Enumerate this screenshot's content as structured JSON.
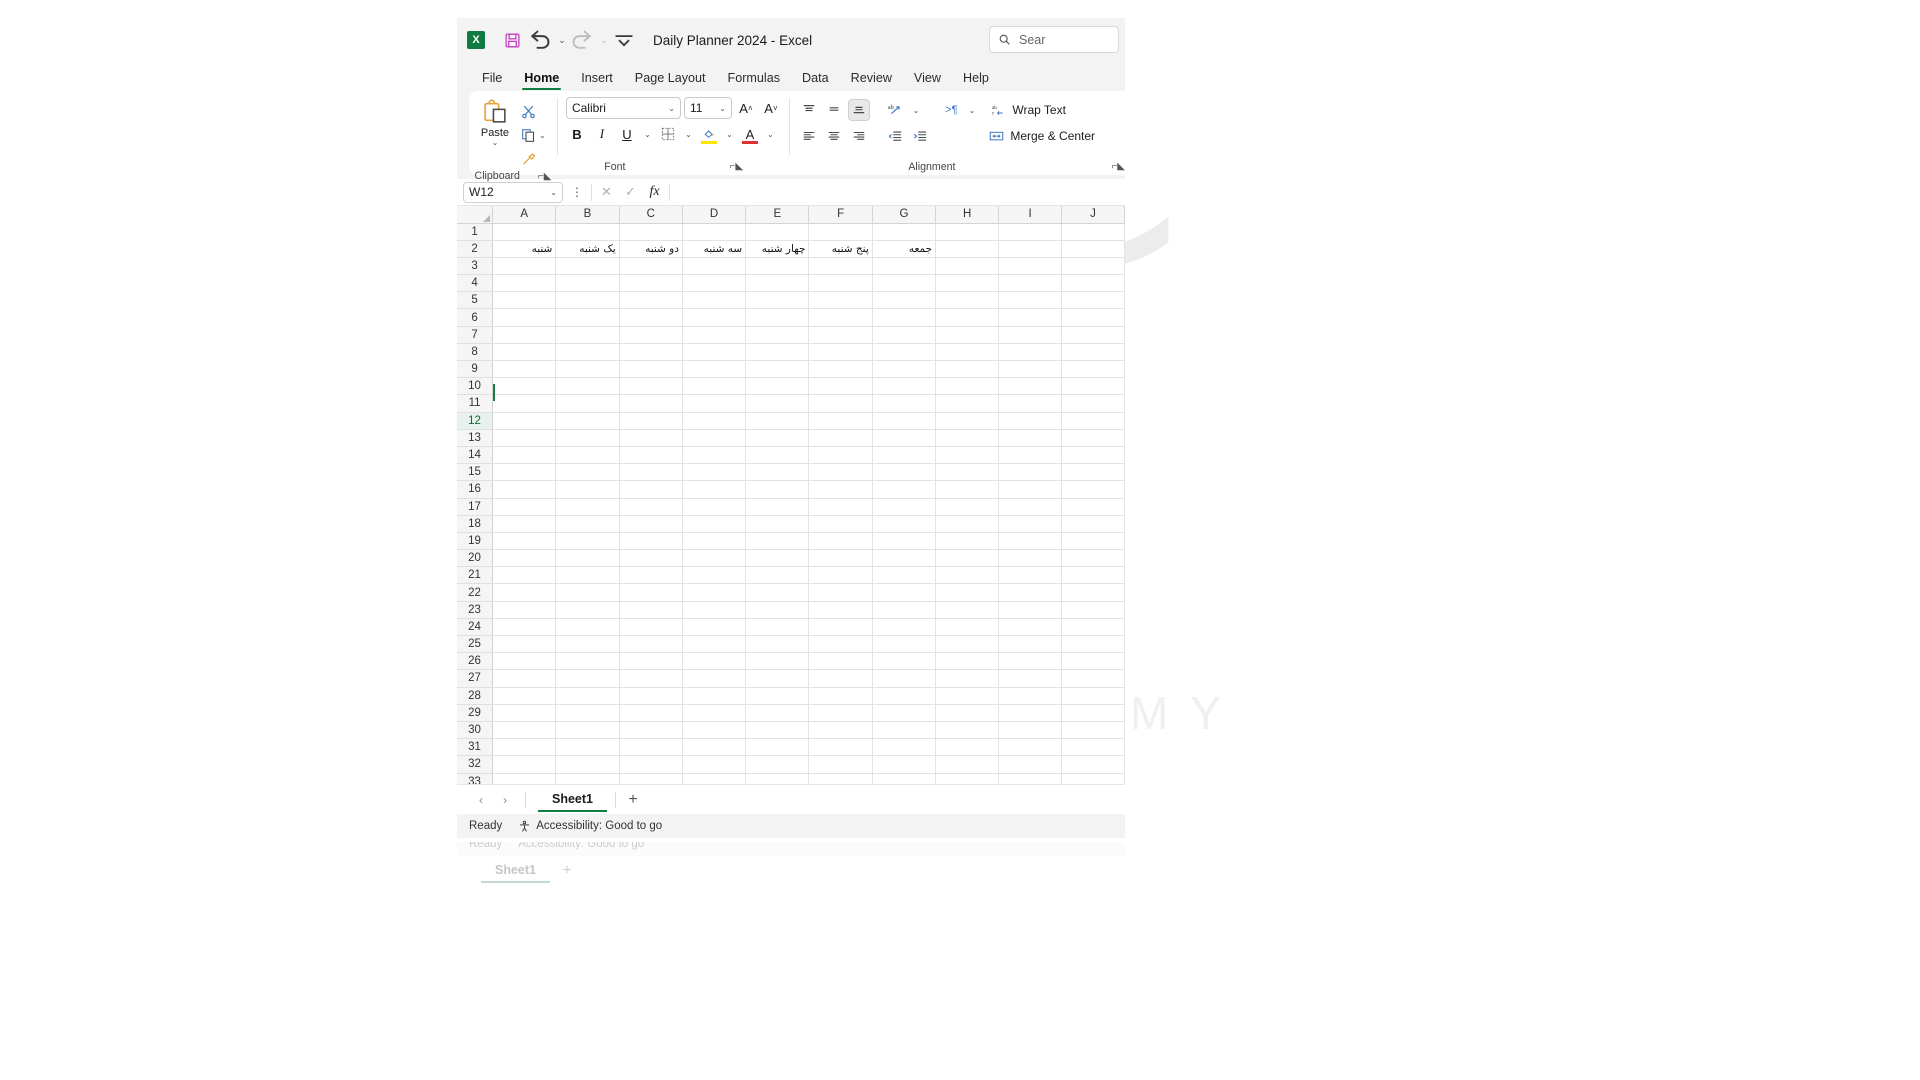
{
  "window": {
    "title": "Daily Planner 2024  -  Excel",
    "app_icon_letter": "X",
    "quick_access": [
      {
        "name": "save-icon",
        "label": "Save"
      },
      {
        "name": "undo-icon",
        "label": "Undo"
      },
      {
        "name": "redo-icon",
        "label": "Redo"
      },
      {
        "name": "customize-qat-icon",
        "label": "Customize Quick Access Toolbar"
      }
    ]
  },
  "search": {
    "placeholder": "Sear",
    "value": "Sear",
    "icon": "search-icon"
  },
  "tabs": [
    {
      "label": "File",
      "active": false
    },
    {
      "label": "Home",
      "active": true
    },
    {
      "label": "Insert",
      "active": false
    },
    {
      "label": "Page Layout",
      "active": false
    },
    {
      "label": "Formulas",
      "active": false
    },
    {
      "label": "Data",
      "active": false
    },
    {
      "label": "Review",
      "active": false
    },
    {
      "label": "View",
      "active": false
    },
    {
      "label": "Help",
      "active": false
    }
  ],
  "ribbon": {
    "clipboard": {
      "label": "Clipboard",
      "paste_label": "Paste",
      "cut_label": "Cut",
      "copy_label": "Copy",
      "format_painter_label": "Format Painter",
      "launcher": "dialog-launcher"
    },
    "font": {
      "label": "Font",
      "font_name": "Calibri",
      "font_size": "11",
      "grow_label": "Increase Font Size",
      "shrink_label": "Decrease Font Size",
      "bold_label": "B",
      "italic_label": "I",
      "underline_label": "U",
      "borders_label": "Borders",
      "fill_color_label": "Fill Color",
      "font_color_label": "Font Color",
      "fill_color": "#ffe600",
      "font_color": "#e03131",
      "launcher": "dialog-launcher"
    },
    "alignment": {
      "label": "Alignment",
      "top_align_label": "Top Align",
      "middle_align_label": "Middle Align",
      "bottom_align_label": "Bottom Align",
      "orientation_label": "Orientation",
      "text_direction_label": "Text Direction",
      "align_left_label": "Align Left",
      "align_center_label": "Center",
      "align_right_label": "Align Right",
      "decrease_indent_label": "Decrease Indent",
      "increase_indent_label": "Increase Indent",
      "wrap_text_label": "Wrap Text",
      "merge_center_label": "Merge & Center",
      "launcher": "dialog-launcher"
    }
  },
  "formula_bar": {
    "name_box_value": "W12",
    "cancel_label": "Cancel",
    "enter_label": "Enter",
    "insert_function_label": "fx",
    "formula_value": ""
  },
  "grid": {
    "columns": [
      "A",
      "B",
      "C",
      "D",
      "E",
      "F",
      "G",
      "H",
      "I",
      "J"
    ],
    "rows": [
      1,
      2,
      3,
      4,
      5,
      6,
      7,
      8,
      9,
      10,
      11,
      12,
      13,
      14,
      15,
      16,
      17,
      18,
      19,
      20,
      21,
      22,
      23,
      24,
      25,
      26,
      27,
      28,
      29,
      30,
      31,
      32,
      33
    ],
    "selected_row": 12,
    "day_row_index": 2,
    "days": [
      {
        "column": "A",
        "text": "شنبه"
      },
      {
        "column": "B",
        "text": "یک شنبه"
      },
      {
        "column": "C",
        "text": "دو شنبه"
      },
      {
        "column": "D",
        "text": "سه شنبه"
      },
      {
        "column": "E",
        "text": "چهار شنبه"
      },
      {
        "column": "F",
        "text": "پنج شنبه"
      },
      {
        "column": "G",
        "text": "جمعه"
      }
    ]
  },
  "sheet_tabs": {
    "prev_label": "‹",
    "next_label": "›",
    "sheets": [
      {
        "name": "Sheet1",
        "active": true
      }
    ],
    "add_label": "+"
  },
  "status_bar": {
    "mode": "Ready",
    "accessibility": "Accessibility: Good to go"
  },
  "watermark": {
    "glyph": "آکا",
    "text": "ATRO ACADEMY"
  }
}
